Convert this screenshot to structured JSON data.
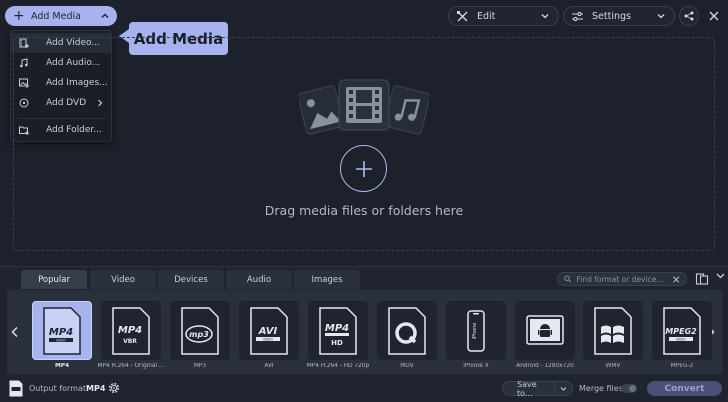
{
  "toolbar": {
    "add_media_label": "Add Media",
    "edit_label": "Edit",
    "settings_label": "Settings"
  },
  "add_menu": {
    "items": [
      {
        "label": "Add Video...",
        "icon": "add-video-icon"
      },
      {
        "label": "Add Audio...",
        "icon": "add-audio-icon"
      },
      {
        "label": "Add Images...",
        "icon": "add-images-icon"
      },
      {
        "label": "Add DVD",
        "icon": "add-dvd-icon"
      },
      {
        "label": "Add Folder...",
        "icon": "add-folder-icon"
      }
    ]
  },
  "tooltip": {
    "text": "Add Media"
  },
  "dropzone": {
    "text": "Drag media files or folders here"
  },
  "tabs": [
    "Popular",
    "Video",
    "Devices",
    "Audio",
    "Images"
  ],
  "search": {
    "placeholder": "Find format or device..."
  },
  "formats": [
    {
      "caption": "MP4",
      "badge": "MP4",
      "sub": "VIDEO"
    },
    {
      "caption": "MP4 H.264 - Original ...",
      "badge": "MP4",
      "sub": "VBR"
    },
    {
      "caption": "MP3",
      "badge": "mp3",
      "sub": ""
    },
    {
      "caption": "AVI",
      "badge": "AVI",
      "sub": "VIDEO"
    },
    {
      "caption": "MP4 H.264 - HD 720p",
      "badge": "MP4",
      "sub": "HD"
    },
    {
      "caption": "MOV",
      "badge": "Q",
      "sub": ""
    },
    {
      "caption": "iPhone X",
      "badge": "iPhone",
      "sub": ""
    },
    {
      "caption": "Android - 1280x720",
      "badge": "android",
      "sub": ""
    },
    {
      "caption": "WMV",
      "badge": "wmv",
      "sub": ""
    },
    {
      "caption": "MPEG-2",
      "badge": "MPEG2",
      "sub": "VIDEO"
    }
  ],
  "footer": {
    "output_label": "Output format:",
    "output_value": "MP4",
    "save_to_label": "Save to...",
    "merge_label": "Merge files:",
    "convert_label": "Convert"
  },
  "colors": {
    "accent": "#a7b3ee",
    "background": "#1c212b",
    "panel": "#1f2430",
    "card": "#2a303c"
  }
}
